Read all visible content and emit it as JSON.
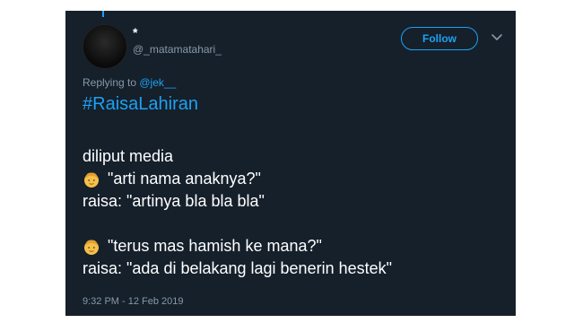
{
  "colors": {
    "background": "#15202b",
    "accent": "#1da1f2",
    "secondary_text": "#8899a6",
    "text": "#ffffff"
  },
  "tweet": {
    "display_name": "*",
    "handle": "@_matamatahari_",
    "follow_label": "Follow",
    "reply_prefix": "Replying to ",
    "reply_mention": "@jek__",
    "hashtag": "#RaisaLahiran",
    "lines": {
      "l1": "diliput media",
      "l2": "\"arti nama anaknya?\"",
      "l3": "raisa: \"artinya bla bla bla\"",
      "l4": "\"terus mas hamish ke mana?\"",
      "l5": "raisa: \"ada di belakang lagi benerin hestek\""
    },
    "emoji_icon": "man-face-emoji-icon",
    "timestamp": "9:32 PM - 12 Feb 2019"
  }
}
